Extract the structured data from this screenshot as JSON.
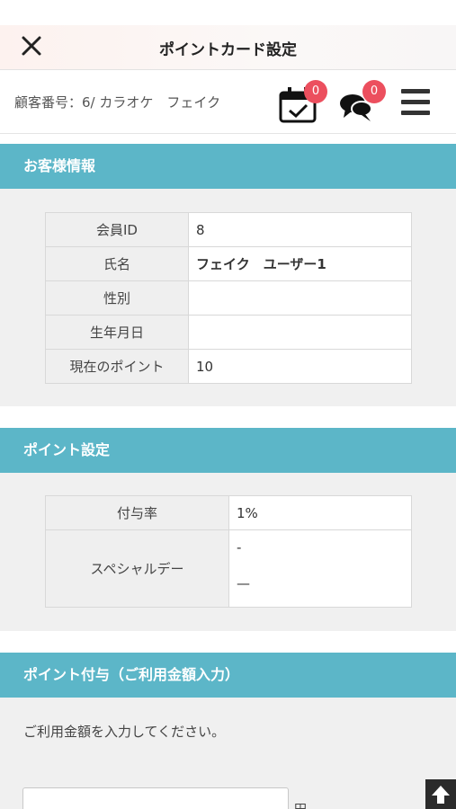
{
  "header": {
    "title": "ポイントカード設定",
    "close_icon": "close-icon"
  },
  "customer_bar": {
    "label": "顧客番号：6/ カラオケ　フェイク",
    "calendar_badge": "0",
    "chat_badge": "0",
    "icons": [
      "calendar-check-icon",
      "chat-bubbles-icon",
      "hamburger-menu-icon"
    ]
  },
  "colors": {
    "section_header": "#5cb6c8",
    "badge": "#ec4f5e",
    "points_value": "#e0404f"
  },
  "customer_info": {
    "heading": "お客様情報",
    "rows": [
      {
        "label": "会員ID",
        "value": "8"
      },
      {
        "label": "氏名",
        "value": "フェイク　ユーザー1"
      },
      {
        "label": "性別",
        "value": ""
      },
      {
        "label": "生年月日",
        "value": ""
      },
      {
        "label": "現在のポイント",
        "value": "10"
      }
    ]
  },
  "point_settings": {
    "heading": "ポイント設定",
    "rate_label": "付与率",
    "rate_value": "1%",
    "special_label": "スペシャルデー",
    "special_line1": "-",
    "special_line2": "—"
  },
  "point_grant": {
    "heading": "ポイント付与（ご利用金額入力）",
    "prompt": "ご利用金額を入力してください。",
    "amount_value": "",
    "unit": "円",
    "scroll_top_icon": "arrow-up-icon"
  }
}
